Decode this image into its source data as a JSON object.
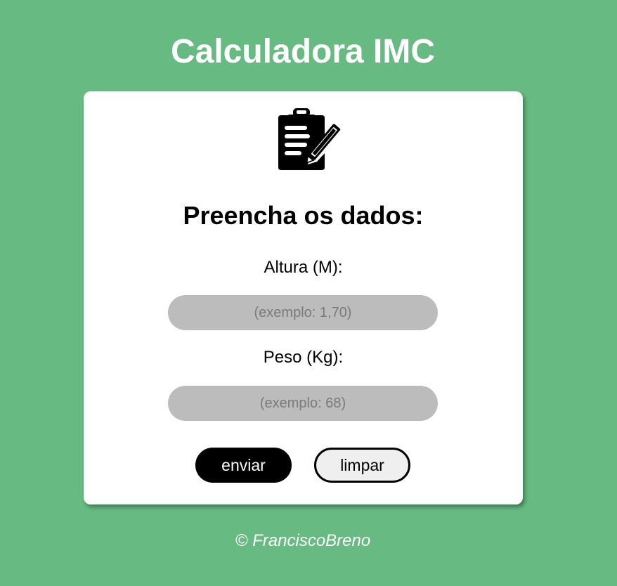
{
  "header": {
    "title": "Calculadora IMC"
  },
  "card": {
    "icon": "clipboard-edit-icon",
    "heading": "Preencha os dados:",
    "fields": [
      {
        "label": "Altura (M):",
        "value": "",
        "placeholder": "(exemplo: 1,70)"
      },
      {
        "label": "Peso (Kg):",
        "value": "",
        "placeholder": "(exemplo: 68)"
      }
    ],
    "buttons": {
      "submit_label": "enviar",
      "clear_label": "limpar"
    }
  },
  "footer": {
    "text": "© FranciscoBreno"
  },
  "colors": {
    "background": "#66ba82",
    "card": "#ffffff",
    "input": "#bcbcbc",
    "submit_button": "#000000",
    "clear_button": "#efefef"
  }
}
